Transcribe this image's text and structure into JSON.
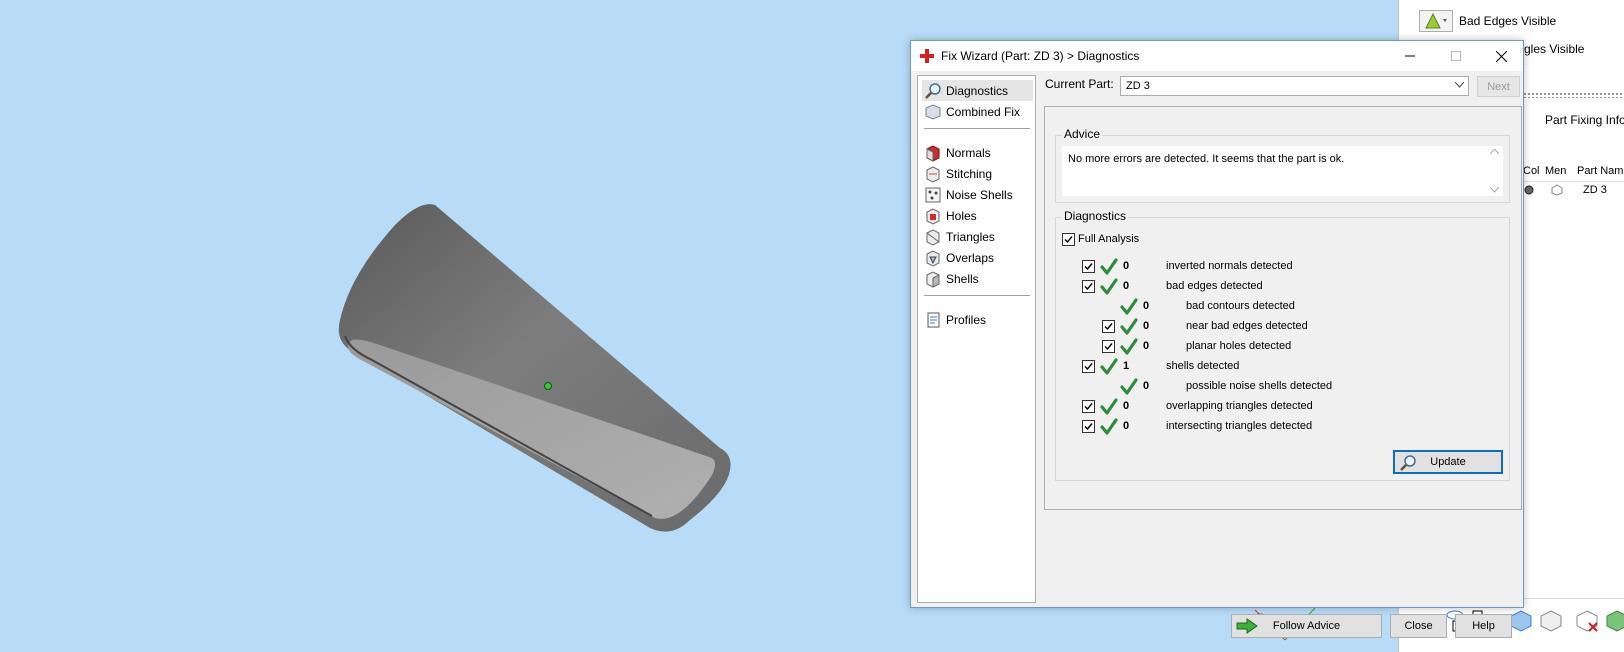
{
  "side_panel": {
    "bad_edges_label": "Bad Edges Visible",
    "triangles_label_partial": "gles Visible",
    "part_fixing_info": "Part Fixing Info",
    "columns": [
      "Col",
      "Men",
      "Part Name"
    ],
    "row_part_name": "ZD 3"
  },
  "dialog": {
    "title": "Fix Wizard (Part: ZD 3) > Diagnostics",
    "nav_items": [
      {
        "label": "Diagnostics",
        "icon": "magnifier-icon"
      },
      {
        "label": "Combined Fix",
        "icon": "combined-fix-icon"
      },
      {
        "label": "Normals",
        "icon": "normals-icon"
      },
      {
        "label": "Stitching",
        "icon": "stitching-icon"
      },
      {
        "label": "Noise Shells",
        "icon": "noise-shells-icon"
      },
      {
        "label": "Holes",
        "icon": "holes-icon"
      },
      {
        "label": "Triangles",
        "icon": "triangles-icon"
      },
      {
        "label": "Overlaps",
        "icon": "overlaps-icon"
      },
      {
        "label": "Shells",
        "icon": "shells-icon"
      },
      {
        "label": "Profiles",
        "icon": "profiles-icon"
      }
    ],
    "current_part_label": "Current Part:",
    "current_part_value": "ZD 3",
    "next_label": "Next",
    "advice_title": "Advice",
    "advice_text": "No more errors are detected. It seems that the part is ok.",
    "diagnostics_title": "Diagnostics",
    "full_analysis_label": "Full Analysis",
    "diagnostics": [
      {
        "count": "0",
        "text": "inverted normals detected",
        "level": 0,
        "has_checkbox": true
      },
      {
        "count": "0",
        "text": "bad edges detected",
        "level": 0,
        "has_checkbox": true
      },
      {
        "count": "0",
        "text": "bad contours detected",
        "level": 1,
        "has_checkbox": false
      },
      {
        "count": "0",
        "text": "near bad edges detected",
        "level": 1,
        "has_checkbox": true
      },
      {
        "count": "0",
        "text": "planar holes detected",
        "level": 1,
        "has_checkbox": true
      },
      {
        "count": "1",
        "text": "shells detected",
        "level": 0,
        "has_checkbox": true
      },
      {
        "count": "0",
        "text": "possible noise shells detected",
        "level": 1,
        "has_checkbox": false
      },
      {
        "count": "0",
        "text": "overlapping triangles detected",
        "level": 0,
        "has_checkbox": true
      },
      {
        "count": "0",
        "text": "intersecting triangles detected",
        "level": 0,
        "has_checkbox": true
      }
    ],
    "update_label": "Update",
    "follow_advice_label": "Follow Advice",
    "close_label": "Close",
    "help_label": "Help"
  },
  "colors": {
    "viewport_bg": "#b8dcf8",
    "check_green": "#2e8b3e",
    "focus_blue": "#0f6fbf"
  }
}
